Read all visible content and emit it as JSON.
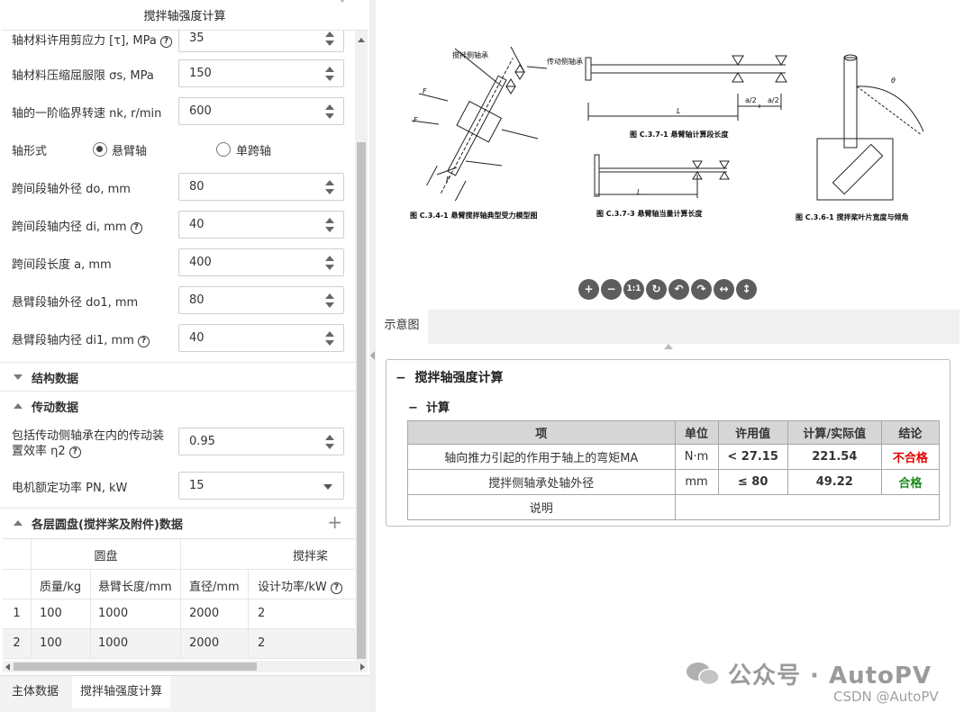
{
  "left_panel": {
    "title": "搅拌轴强度计算",
    "fields": [
      {
        "label": "轴材料许用剪应力 [τ], MPa",
        "value": "35",
        "help": true
      },
      {
        "label": "轴材料压缩屈服限 σs, MPa",
        "value": "150"
      },
      {
        "label": "轴的一阶临界转速 nk, r/min",
        "value": "600"
      },
      {
        "label": "跨间段轴外径 do, mm",
        "value": "80"
      },
      {
        "label": "跨间段轴内径 di, mm",
        "value": "40",
        "help": true
      },
      {
        "label": "跨间段长度 a, mm",
        "value": "400"
      },
      {
        "label": "悬臂段轴外径 do1, mm",
        "value": "80"
      },
      {
        "label": "悬臂段轴内径 di1, mm",
        "value": "40",
        "help": true
      }
    ],
    "shaft_form": {
      "label": "轴形式",
      "option1": "悬臂轴",
      "option2": "单跨轴",
      "selected": "悬臂轴"
    },
    "section_structure": "结构数据",
    "section_transmission": "传动数据",
    "efficiency": {
      "label_line1": "包括传动侧轴承在内的传动装",
      "label_line2": "置效率 η2",
      "value": "0.95"
    },
    "motor": {
      "label": "电机额定功率 PN, kW",
      "value": "15"
    },
    "section_disks": "各层圆盘(搅拌桨及附件)数据",
    "grid": {
      "group1": "圆盘",
      "group2": "搅拌桨",
      "columns": [
        "质量/kg",
        "悬臂长度/mm",
        "直径/mm",
        "设计功率/kW"
      ],
      "rows": [
        {
          "n": "1",
          "cells": [
            "100",
            "1000",
            "2000",
            "2"
          ]
        },
        {
          "n": "2",
          "cells": [
            "100",
            "1000",
            "2000",
            "2"
          ]
        }
      ]
    },
    "bottom_tabs": [
      "主体数据",
      "搅拌轴强度计算"
    ]
  },
  "right_panel": {
    "diagram_tab": "示意图",
    "toolbar_icons": [
      "zoom-in-icon",
      "zoom-out-icon",
      "actual-size-icon",
      "reset-icon",
      "undo-icon",
      "redo-icon",
      "flip-horizontal-icon",
      "flip-vertical-icon"
    ],
    "toolbar_glyphs": [
      "+",
      "−",
      "1:1",
      "↻",
      "↶",
      "↷",
      "↔",
      "↕"
    ],
    "figures": {
      "fig1_caption": "图 C.3.4-1  悬臂搅拌轴典型受力模型图",
      "fig2_caption": "图 C.3.7-1  悬臂轴计算段长度",
      "fig3_caption": "图 C.3.7-3  悬臂轴当量计算长度",
      "fig4_caption": "图 C.3.6-1  搅拌桨叶片宽度与倾角",
      "label_stir_bearing": "搅拌侧轴承",
      "label_drive_bearing": "传动侧轴承"
    },
    "results": {
      "panel_title": "搅拌轴强度计算",
      "sub_title": "计算",
      "headers": [
        "项",
        "单位",
        "许用值",
        "计算/实际值",
        "结论"
      ],
      "rows": [
        {
          "item": "轴向推力引起的作用于轴上的弯矩MA",
          "unit": "N·m",
          "allowed": "< 27.15",
          "actual": "221.54",
          "conclusion": "不合格"
        },
        {
          "item": "搅拌侧轴承处轴外径",
          "unit": "mm",
          "allowed": "≤ 80",
          "actual": "49.22",
          "conclusion": "合格"
        },
        {
          "item": "说明",
          "unit": "",
          "allowed": "",
          "actual": "",
          "conclusion": ""
        }
      ]
    }
  },
  "watermark": {
    "main": "公众号 · AutoPV",
    "sub": "CSDN @AutoPV"
  }
}
